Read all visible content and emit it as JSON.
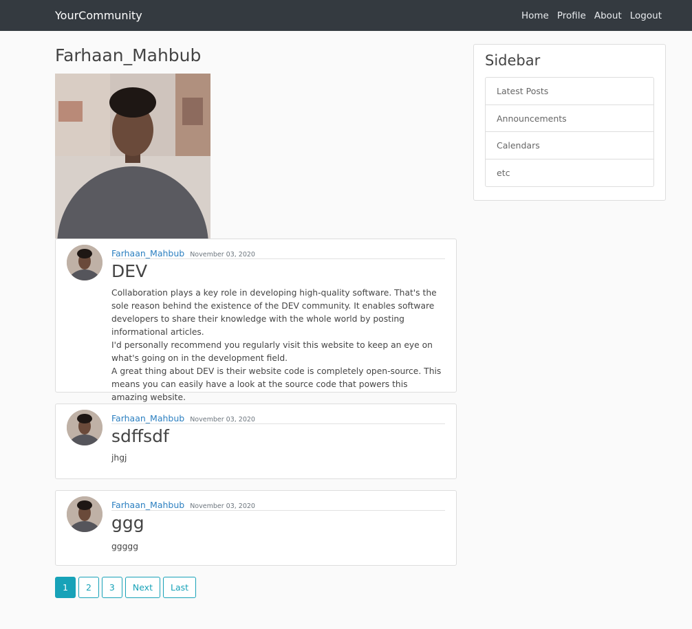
{
  "nav": {
    "brand": "YourCommunity",
    "links": [
      "Home",
      "Profile",
      "About",
      "Logout"
    ]
  },
  "profile": {
    "name": "Farhaan_Mahbub"
  },
  "posts": [
    {
      "author": "Farhaan_Mahbub",
      "date": "November 03, 2020",
      "title": "DEV",
      "content": [
        "Collaboration plays a key role in developing high-quality software. That's the sole reason behind the existence of the DEV community. It enables software developers to share their knowledge with the whole world by posting informational articles.",
        "I'd personally recommend you regularly visit this website to keep an eye on what's going on in the development field.",
        "A great thing about DEV is their website code is completely open-source. This means you can easily have a look at the source code that powers this amazing website."
      ]
    },
    {
      "author": "Farhaan_Mahbub",
      "date": "November 03, 2020",
      "title": "sdffsdf",
      "content": [
        "jhgj"
      ]
    },
    {
      "author": "Farhaan_Mahbub",
      "date": "November 03, 2020",
      "title": "ggg",
      "content": [
        "ggggg"
      ]
    }
  ],
  "sidebar": {
    "title": "Sidebar",
    "items": [
      "Latest Posts",
      "Announcements",
      "Calendars",
      "etc"
    ]
  },
  "pagination": {
    "pages": [
      "1",
      "2",
      "3"
    ],
    "next": "Next",
    "last": "Last",
    "active": "1"
  },
  "colors": {
    "navbar": "#343a40",
    "link": "#2b7fc0",
    "accent": "#17a2b8"
  }
}
